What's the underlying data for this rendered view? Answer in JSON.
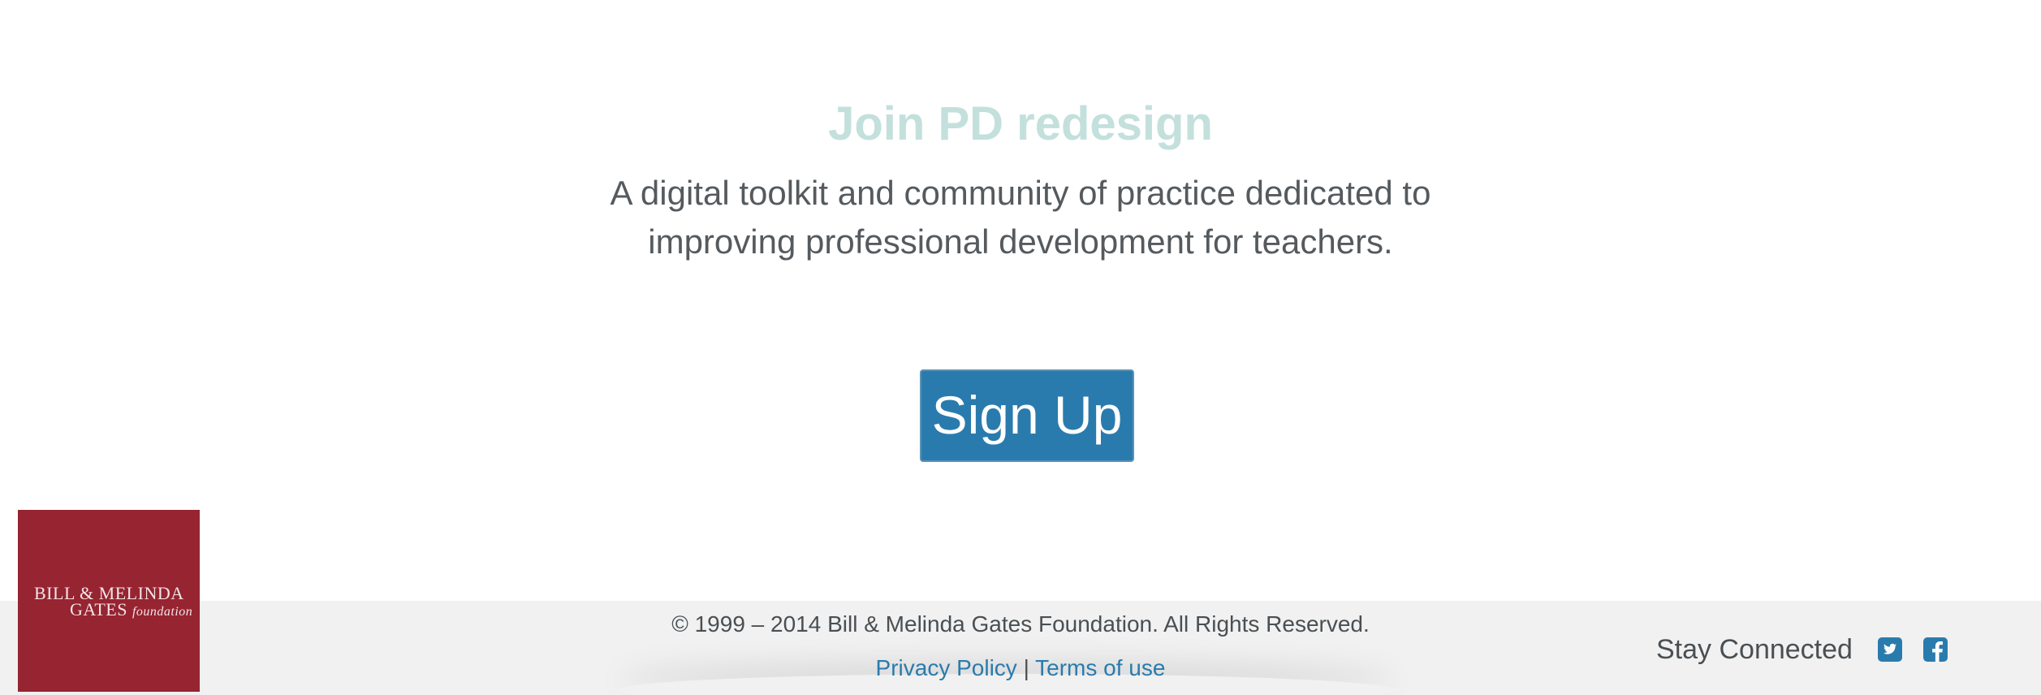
{
  "hero": {
    "title": "Join PD redesign",
    "subtitle": "A digital toolkit and community of practice dedicated to improving professional development for teachers.",
    "signup_label": "Sign Up"
  },
  "footer": {
    "logo": {
      "line1": "BILL & MELINDA",
      "line2": "GATES",
      "line2_suffix": "foundation"
    },
    "copyright": "© 1999 – 2014 Bill & Melinda Gates Foundation. All Rights Reserved.",
    "privacy_label": "Privacy Policy",
    "separator": "|",
    "terms_label": "Terms of use",
    "stay_connected": "Stay Connected",
    "social_icons": [
      "twitter-icon",
      "facebook-icon"
    ]
  },
  "colors": {
    "accent": "#2a7bad",
    "title": "#c3e0dc",
    "logo_bg": "#962431",
    "footer_bg": "#f1f1f1",
    "text": "#555a5e"
  }
}
